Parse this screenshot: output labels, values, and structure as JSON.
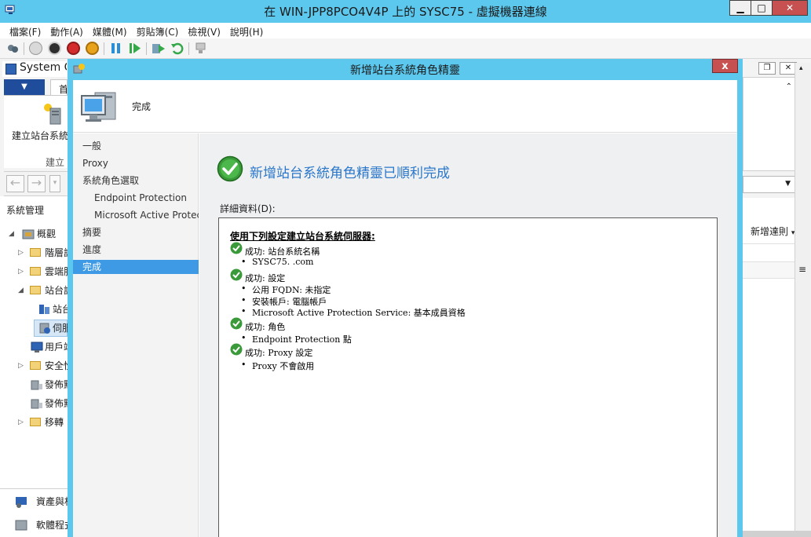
{
  "vm_window": {
    "title": "在 WIN-JPP8PCO4V4P 上的 SYSC75 - 虛擬機器連線"
  },
  "menu": [
    "檔案(F)",
    "動作(A)",
    "媒體(M)",
    "剪貼簿(C)",
    "檢視(V)",
    "說明(H)"
  ],
  "toolbar_icons": [
    "ctrl-alt-del-icon",
    "start-icon",
    "turn-off-icon",
    "shutdown-icon",
    "power-icon",
    "pause-icon",
    "resume-icon",
    "checkpoint-icon",
    "revert-icon",
    "enhanced-session-icon"
  ],
  "console": {
    "title": "System C",
    "home_tab": "首",
    "create_button": "建立站台系統",
    "create_group": "建立",
    "tree_title": "系統管理",
    "tree": [
      {
        "label": "概觀",
        "level": 1,
        "expanded": true
      },
      {
        "label": "階層設",
        "level": 2
      },
      {
        "label": "雲端服",
        "level": 2
      },
      {
        "label": "站台設",
        "level": 2,
        "expanded": true
      },
      {
        "label": "站台",
        "level": 3
      },
      {
        "label": "伺服",
        "level": 3,
        "selected": true
      },
      {
        "label": "用戶端",
        "level": 2
      },
      {
        "label": "安全性",
        "level": 2
      },
      {
        "label": "發佈點",
        "level": 2
      },
      {
        "label": "發佈點",
        "level": 2
      },
      {
        "label": "移轉",
        "level": 2
      }
    ],
    "bottom_nav": [
      "資產與相",
      "軟體程式"
    ],
    "right_pane": {
      "new_rule": "新增達則"
    }
  },
  "wizard": {
    "title": "新增站台系統角色精靈",
    "page_title": "完成",
    "steps": [
      {
        "label": "一般",
        "indent": false
      },
      {
        "label": "Proxy",
        "indent": false
      },
      {
        "label": "系統角色選取",
        "indent": false
      },
      {
        "label": "Endpoint Protection",
        "indent": true
      },
      {
        "label": "Microsoft Active Protect",
        "indent": true
      },
      {
        "label": "摘要",
        "indent": false
      },
      {
        "label": "進度",
        "indent": false
      },
      {
        "label": "完成",
        "indent": false,
        "current": true
      }
    ],
    "success_heading": "新增站台系統角色精靈已順利完成",
    "details_label": "詳細資料(D):",
    "details": {
      "header": "使用下列設定建立站台系統伺服器:",
      "groups": [
        {
          "status": "成功: 站台系統名稱",
          "items": [
            "SYSC75.          .com"
          ]
        },
        {
          "status": "成功: 設定",
          "items": [
            "公用 FQDN: 未指定",
            "安裝帳戶: 電腦帳戶",
            "Microsoft Active Protection Service: 基本成員資格"
          ]
        },
        {
          "status": "成功: 角色",
          "items": [
            "Endpoint Protection 點"
          ]
        },
        {
          "status": "成功: Proxy 設定",
          "items": [
            "Proxy 不會啟用"
          ]
        }
      ]
    }
  },
  "colors": {
    "title_bar": "#5cc8ee",
    "success_heading": "#2a77c9",
    "selected_step": "#3e9ae4",
    "close_button": "#c75050"
  }
}
